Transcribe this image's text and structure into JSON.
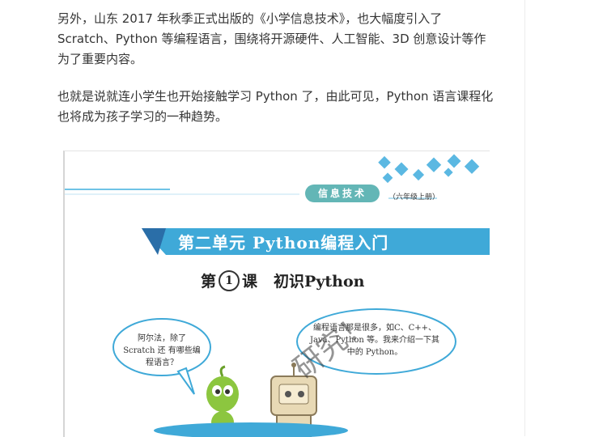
{
  "article": {
    "paragraph1": "另外，山东 2017 年秋季正式出版的《小学信息技术》，也大幅度引入了Scratch、Python 等编程语言，围绕将开源硬件、人工智能、3D 创意设计等作为了重要内容。",
    "paragraph2": "也就是说就连小学生也开始接触学习 Python 了，由此可见，Python 语言课程化也将成为孩子学习的一种趋势。"
  },
  "book_page": {
    "header_tag": "信息技术",
    "header_grade": "（六年级上册）",
    "unit_title": "第二单元  Python编程入门",
    "lesson_prefix": "第",
    "lesson_number": "1",
    "lesson_suffix": "课",
    "lesson_title": "初识Python",
    "bubble_left": "阿尔法，除了 Scratch 还 有哪些编程语言？",
    "bubble_right": "编程语言那是很多，如C、C++、Java、Python 等。我来介绍一下其中的 Python。",
    "watermark": "研究！"
  },
  "colors": {
    "banner": "#3fa9d8",
    "header_tag": "#63b6b6",
    "diamonds": "#5bb8e2",
    "green_character": "#8cc63f"
  }
}
